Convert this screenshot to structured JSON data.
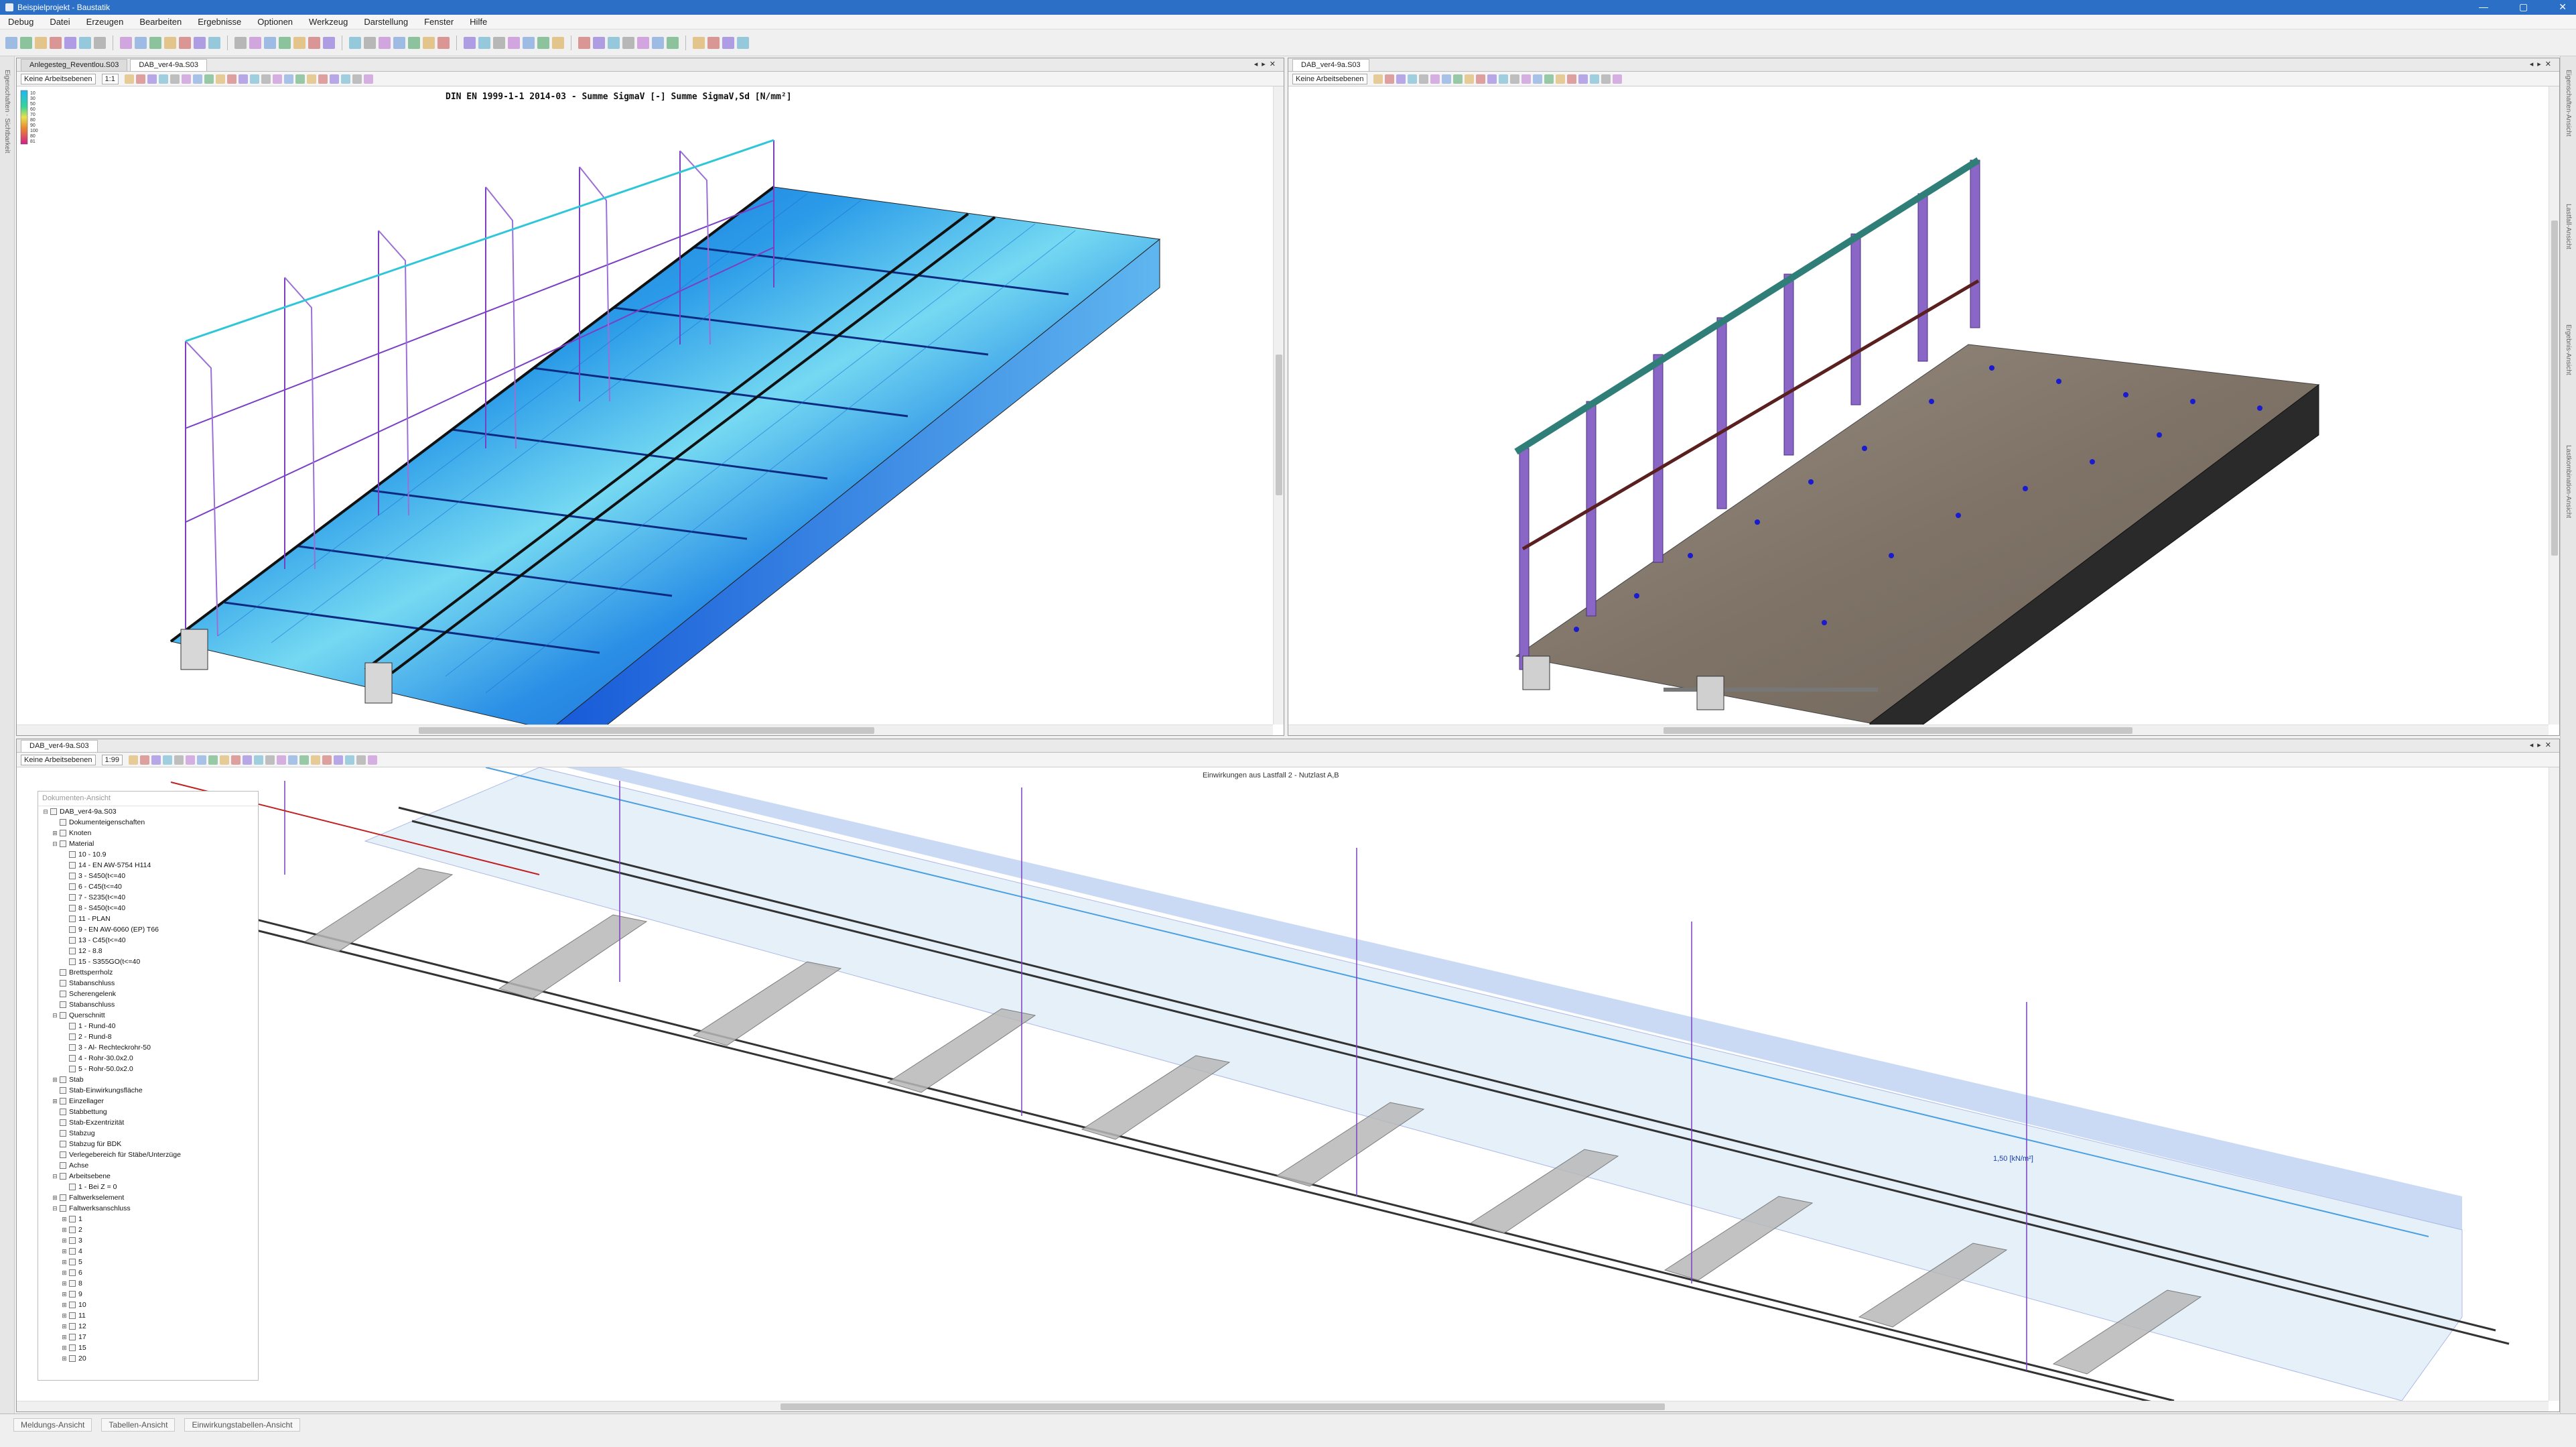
{
  "window": {
    "title": "Beispielprojekt - Baustatik",
    "controls": [
      "—",
      "▢",
      "✕"
    ]
  },
  "menu": [
    "Debug",
    "Datei",
    "Erzeugen",
    "Bearbeiten",
    "Ergebnisse",
    "Optionen",
    "Werkzeug",
    "Darstellung",
    "Fenster",
    "Hilfe"
  ],
  "left_strip_label": "Eigenschaften · Sichtbarkeit",
  "right_strip_labels": [
    "Eigenschaften-Ansicht",
    "Lastfall-Ansicht",
    "Ergebnis-Ansicht",
    "Lastkombination-Ansicht"
  ],
  "panes": {
    "top_left": {
      "tabs": [
        "Anlegesteg_Reventlou.S03",
        "DAB_ver4-9a.S03"
      ],
      "active_tab": 1,
      "workplane": "Keine Arbeitsebenen",
      "zoom": "1:1",
      "result_title": "DIN EN 1999-1-1 2014-03 - Summe SigmaV [-] Summe SigmaV,Sd [N/mm²]",
      "legend_values": [
        "10",
        "30",
        "50",
        "60",
        "70",
        "80",
        "90",
        "100",
        "80",
        "81"
      ]
    },
    "top_right": {
      "tabs": [
        "DAB_ver4-9a.S03"
      ],
      "active_tab": 0,
      "workplane": "Keine Arbeitsebenen"
    },
    "bottom": {
      "tabs": [
        "DAB_ver4-9a.S03"
      ],
      "active_tab": 0,
      "workplane": "Keine Arbeitsebenen",
      "zoom": "1:99",
      "load_title": "Einwirkungen aus Lastfall 2 - Nutzlast A,B",
      "load_value": "1,50 [kN/m²]"
    }
  },
  "navigator": {
    "title": "Dokumenten-Ansicht",
    "items": [
      {
        "label": "DAB_ver4-9a.S03",
        "indent": 0,
        "exp": "⊟"
      },
      {
        "label": "Dokumenteigenschaften",
        "indent": 1,
        "exp": ""
      },
      {
        "label": "Knoten",
        "indent": 1,
        "exp": "⊞"
      },
      {
        "label": "Material",
        "indent": 1,
        "exp": "⊟"
      },
      {
        "label": "10 - 10.9",
        "indent": 2,
        "exp": ""
      },
      {
        "label": "14 - EN AW-5754 H114",
        "indent": 2,
        "exp": ""
      },
      {
        "label": "3 - S450(t<=40",
        "indent": 2,
        "exp": ""
      },
      {
        "label": "6 - C45(t<=40",
        "indent": 2,
        "exp": ""
      },
      {
        "label": "7 - S235(t<=40",
        "indent": 2,
        "exp": ""
      },
      {
        "label": "8 - S450(t<=40",
        "indent": 2,
        "exp": ""
      },
      {
        "label": "11 - PLAN",
        "indent": 2,
        "exp": ""
      },
      {
        "label": "9 - EN AW-6060 (EP) T66",
        "indent": 2,
        "exp": ""
      },
      {
        "label": "13 - C45(t<=40",
        "indent": 2,
        "exp": ""
      },
      {
        "label": "12 - 8.8",
        "indent": 2,
        "exp": ""
      },
      {
        "label": "15 - S355GO(t<=40",
        "indent": 2,
        "exp": ""
      },
      {
        "label": "Brettsperrholz",
        "indent": 1,
        "exp": ""
      },
      {
        "label": "Stabanschluss",
        "indent": 1,
        "exp": ""
      },
      {
        "label": "Scherengelenk",
        "indent": 1,
        "exp": ""
      },
      {
        "label": "Stabanschluss",
        "indent": 1,
        "exp": ""
      },
      {
        "label": "Querschnitt",
        "indent": 1,
        "exp": "⊟"
      },
      {
        "label": "1 - Rund-40",
        "indent": 2,
        "exp": ""
      },
      {
        "label": "2 - Rund-8",
        "indent": 2,
        "exp": ""
      },
      {
        "label": "3 - Al- Rechteckrohr-50",
        "indent": 2,
        "exp": ""
      },
      {
        "label": "4 - Rohr-30.0x2.0",
        "indent": 2,
        "exp": ""
      },
      {
        "label": "5 - Rohr-50.0x2.0",
        "indent": 2,
        "exp": ""
      },
      {
        "label": "Stab",
        "indent": 1,
        "exp": "⊞"
      },
      {
        "label": "Stab-Einwirkungsfläche",
        "indent": 1,
        "exp": ""
      },
      {
        "label": "Einzellager",
        "indent": 1,
        "exp": "⊞"
      },
      {
        "label": "Stabbettung",
        "indent": 1,
        "exp": ""
      },
      {
        "label": "Stab-Exzentrizität",
        "indent": 1,
        "exp": ""
      },
      {
        "label": "Stabzug",
        "indent": 1,
        "exp": ""
      },
      {
        "label": "Stabzug für BDK",
        "indent": 1,
        "exp": ""
      },
      {
        "label": "Verlegebereich für Stäbe/Unterzüge",
        "indent": 1,
        "exp": ""
      },
      {
        "label": "Achse",
        "indent": 1,
        "exp": ""
      },
      {
        "label": "Arbeitsebene",
        "indent": 1,
        "exp": "⊟"
      },
      {
        "label": "1 - Bei Z = 0",
        "indent": 2,
        "exp": ""
      },
      {
        "label": "Faltwerkselement",
        "indent": 1,
        "exp": "⊞"
      },
      {
        "label": "Faltwerksanschluss",
        "indent": 1,
        "exp": "⊟"
      },
      {
        "label": "1",
        "indent": 2,
        "exp": "⊞"
      },
      {
        "label": "2",
        "indent": 2,
        "exp": "⊞"
      },
      {
        "label": "3",
        "indent": 2,
        "exp": "⊞"
      },
      {
        "label": "4",
        "indent": 2,
        "exp": "⊞"
      },
      {
        "label": "5",
        "indent": 2,
        "exp": "⊞"
      },
      {
        "label": "6",
        "indent": 2,
        "exp": "⊞"
      },
      {
        "label": "8",
        "indent": 2,
        "exp": "⊞"
      },
      {
        "label": "9",
        "indent": 2,
        "exp": "⊞"
      },
      {
        "label": "10",
        "indent": 2,
        "exp": "⊞"
      },
      {
        "label": "11",
        "indent": 2,
        "exp": "⊞"
      },
      {
        "label": "12",
        "indent": 2,
        "exp": "⊞"
      },
      {
        "label": "17",
        "indent": 2,
        "exp": "⊞"
      },
      {
        "label": "15",
        "indent": 2,
        "exp": "⊞"
      },
      {
        "label": "20",
        "indent": 2,
        "exp": "⊞"
      }
    ]
  },
  "status_tabs": [
    "Meldungs-Ansicht",
    "Tabellen-Ansicht",
    "Einwirkungstabellen-Ansicht"
  ],
  "colors": {
    "accent": "#2b6fc7",
    "stress_low": "#1a6fe0",
    "stress_high": "#7de0f0",
    "member": "#9b6fd6",
    "rail": "#2f7f78",
    "deck": "#8a7f72",
    "glass": "#c9dff2"
  }
}
